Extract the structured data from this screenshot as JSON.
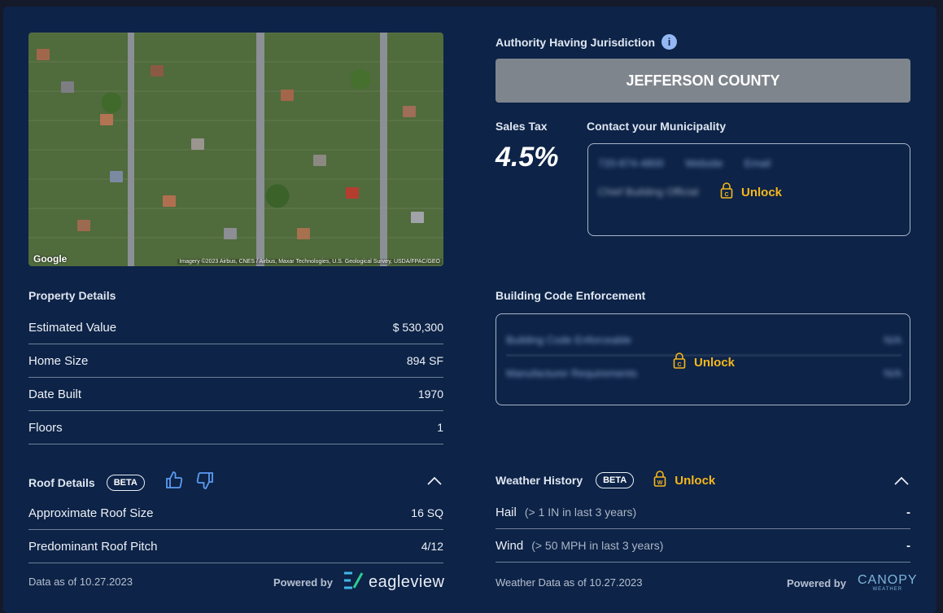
{
  "map": {
    "google_label": "Google",
    "credit": "Imagery ©2023 Airbus, CNES / Airbus, Maxar Technologies, U.S. Geological Survey, USDA/FPAC/GEO"
  },
  "property": {
    "title": "Property Details",
    "rows": [
      {
        "label": "Estimated Value",
        "value": "$ 530,300"
      },
      {
        "label": "Home Size",
        "value": "894 SF"
      },
      {
        "label": "Date Built",
        "value": "1970"
      },
      {
        "label": "Floors",
        "value": "1"
      }
    ]
  },
  "roof": {
    "title": "Roof Details",
    "badge": "BETA",
    "rows": [
      {
        "label": "Approximate Roof Size",
        "value": "16 SQ"
      },
      {
        "label": "Predominant Roof Pitch",
        "value": "4/12"
      }
    ],
    "footer": "Data as of 10.27.2023",
    "powered_by": "Powered by",
    "brand": "eagleview"
  },
  "jurisdiction": {
    "title": "Authority Having Jurisdiction",
    "value": "JEFFERSON COUNTY"
  },
  "sales_tax": {
    "label": "Sales Tax",
    "value": "4.5%"
  },
  "municipality": {
    "title": "Contact your Municipality",
    "phone": "720-874-4800",
    "website": "Website",
    "email": "Email",
    "official": "Chief Building Official",
    "unlock_label": "Unlock"
  },
  "code_enforcement": {
    "title": "Building Code Enforcement",
    "rows": [
      {
        "label": "Building Code Enforceable",
        "value": "N/A"
      },
      {
        "label": "Manufacturer Requirements",
        "value": "N/A"
      }
    ],
    "unlock_label": "Unlock"
  },
  "weather": {
    "title": "Weather History",
    "badge": "BETA",
    "unlock_label": "Unlock",
    "rows": [
      {
        "label": "Hail",
        "sub": "(> 1 IN in last 3 years)",
        "value": "-"
      },
      {
        "label": "Wind",
        "sub": "(> 50 MPH in last 3 years)",
        "value": "-"
      }
    ],
    "footer": "Weather Data as of 10.27.2023",
    "powered_by": "Powered by",
    "brand": "CANOPY",
    "brand_sub": "WEATHER"
  },
  "colors": {
    "accent": "#f5b71b",
    "panel": "#0d2347",
    "jurisdiction_box": "#7f858c",
    "info": "#93b8f4"
  }
}
